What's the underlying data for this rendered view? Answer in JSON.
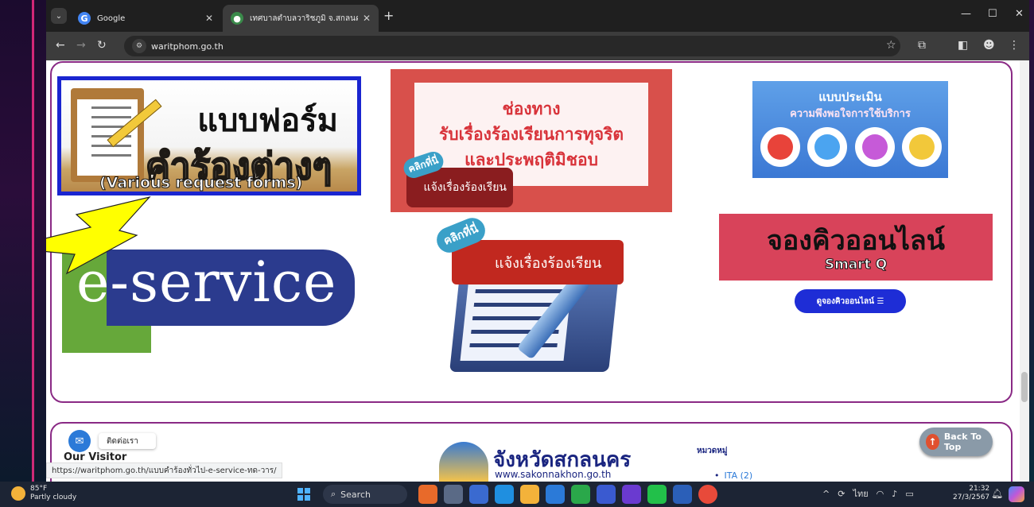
{
  "browser": {
    "tabs": [
      {
        "label": "Google",
        "active": false
      },
      {
        "label": "เทศบาลตำบลวาริชภูมิ จ.สกลนคร – ",
        "active": true
      }
    ],
    "address": "waritphom.go.th",
    "status_url": "https://waritphom.go.th/แบบคำร้องทั่วไป-e-service-ทด-วาร/"
  },
  "cards": {
    "forms": {
      "line1": "แบบฟอร์ม",
      "line2": "คำร้องต่างๆ",
      "line3": "(Various request forms)"
    },
    "complaint": {
      "line1": "ช่องทาง",
      "line2": "รับเรื่องร้องเรียนการทุจริต",
      "line3": "และประพฤติมิชอบ",
      "click_label": "คลิกที่นี่",
      "badge_label": "แจ้งเรื่องร้องเรียน"
    },
    "survey": {
      "line1": "แบบประเมิน",
      "line2": "ความพึงพอใจการใช้บริการ"
    },
    "eservice": {
      "prefix": "e-",
      "word": "service"
    },
    "report": {
      "click_label": "คลิกที่นี่",
      "badge_label": "แจ้งเรื่องร้องเรียน"
    },
    "queue": {
      "title": "จองคิวออนไลน์",
      "subtitle": "Smart Q",
      "button_label": "ดูจองคิวออนไลน์ ☰"
    }
  },
  "footer": {
    "contact_label": "ติดต่อเรา",
    "visitor_title": "Our Visitor",
    "province_name": "จังหวัดสกลนคร",
    "province_url": "www.sakonnakhon.go.th",
    "category_heading": "หมวดหมู่",
    "category_item": "ITA",
    "category_count": "(2)",
    "back_to_top": "Back To Top"
  },
  "taskbar": {
    "weather_temp": "85°F",
    "weather_desc": "Partly cloudy",
    "search_label": "Search",
    "lang": "ไทย",
    "time": "21:32",
    "date": "27/3/2567"
  },
  "colors": {
    "panel_border": "#8a2a85",
    "queue_button": "#1e2dd6",
    "arrow": "#ffff00"
  }
}
